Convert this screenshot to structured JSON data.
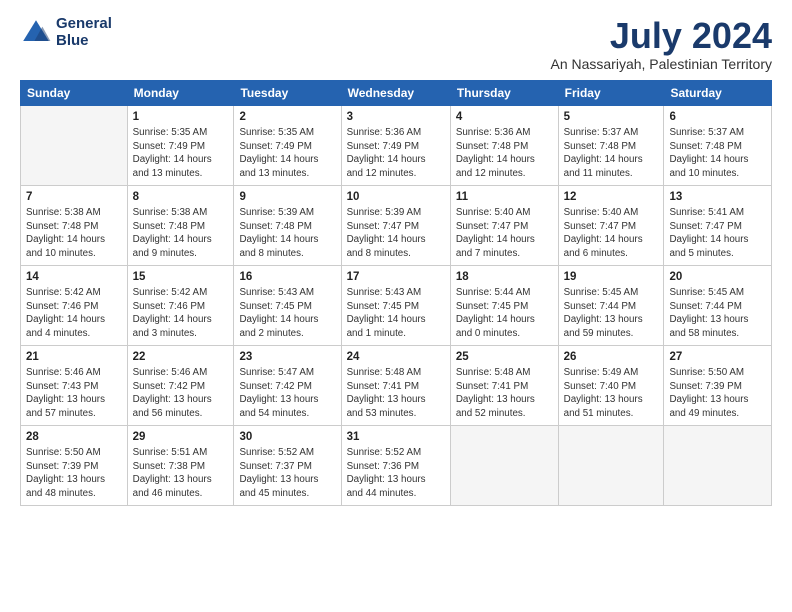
{
  "logo": {
    "line1": "General",
    "line2": "Blue"
  },
  "title": "July 2024",
  "subtitle": "An Nassariyah, Palestinian Territory",
  "header_days": [
    "Sunday",
    "Monday",
    "Tuesday",
    "Wednesday",
    "Thursday",
    "Friday",
    "Saturday"
  ],
  "weeks": [
    [
      {
        "day": "",
        "detail": ""
      },
      {
        "day": "1",
        "detail": "Sunrise: 5:35 AM\nSunset: 7:49 PM\nDaylight: 14 hours\nand 13 minutes."
      },
      {
        "day": "2",
        "detail": "Sunrise: 5:35 AM\nSunset: 7:49 PM\nDaylight: 14 hours\nand 13 minutes."
      },
      {
        "day": "3",
        "detail": "Sunrise: 5:36 AM\nSunset: 7:49 PM\nDaylight: 14 hours\nand 12 minutes."
      },
      {
        "day": "4",
        "detail": "Sunrise: 5:36 AM\nSunset: 7:48 PM\nDaylight: 14 hours\nand 12 minutes."
      },
      {
        "day": "5",
        "detail": "Sunrise: 5:37 AM\nSunset: 7:48 PM\nDaylight: 14 hours\nand 11 minutes."
      },
      {
        "day": "6",
        "detail": "Sunrise: 5:37 AM\nSunset: 7:48 PM\nDaylight: 14 hours\nand 10 minutes."
      }
    ],
    [
      {
        "day": "7",
        "detail": "Sunrise: 5:38 AM\nSunset: 7:48 PM\nDaylight: 14 hours\nand 10 minutes."
      },
      {
        "day": "8",
        "detail": "Sunrise: 5:38 AM\nSunset: 7:48 PM\nDaylight: 14 hours\nand 9 minutes."
      },
      {
        "day": "9",
        "detail": "Sunrise: 5:39 AM\nSunset: 7:48 PM\nDaylight: 14 hours\nand 8 minutes."
      },
      {
        "day": "10",
        "detail": "Sunrise: 5:39 AM\nSunset: 7:47 PM\nDaylight: 14 hours\nand 8 minutes."
      },
      {
        "day": "11",
        "detail": "Sunrise: 5:40 AM\nSunset: 7:47 PM\nDaylight: 14 hours\nand 7 minutes."
      },
      {
        "day": "12",
        "detail": "Sunrise: 5:40 AM\nSunset: 7:47 PM\nDaylight: 14 hours\nand 6 minutes."
      },
      {
        "day": "13",
        "detail": "Sunrise: 5:41 AM\nSunset: 7:47 PM\nDaylight: 14 hours\nand 5 minutes."
      }
    ],
    [
      {
        "day": "14",
        "detail": "Sunrise: 5:42 AM\nSunset: 7:46 PM\nDaylight: 14 hours\nand 4 minutes."
      },
      {
        "day": "15",
        "detail": "Sunrise: 5:42 AM\nSunset: 7:46 PM\nDaylight: 14 hours\nand 3 minutes."
      },
      {
        "day": "16",
        "detail": "Sunrise: 5:43 AM\nSunset: 7:45 PM\nDaylight: 14 hours\nand 2 minutes."
      },
      {
        "day": "17",
        "detail": "Sunrise: 5:43 AM\nSunset: 7:45 PM\nDaylight: 14 hours\nand 1 minute."
      },
      {
        "day": "18",
        "detail": "Sunrise: 5:44 AM\nSunset: 7:45 PM\nDaylight: 14 hours\nand 0 minutes."
      },
      {
        "day": "19",
        "detail": "Sunrise: 5:45 AM\nSunset: 7:44 PM\nDaylight: 13 hours\nand 59 minutes."
      },
      {
        "day": "20",
        "detail": "Sunrise: 5:45 AM\nSunset: 7:44 PM\nDaylight: 13 hours\nand 58 minutes."
      }
    ],
    [
      {
        "day": "21",
        "detail": "Sunrise: 5:46 AM\nSunset: 7:43 PM\nDaylight: 13 hours\nand 57 minutes."
      },
      {
        "day": "22",
        "detail": "Sunrise: 5:46 AM\nSunset: 7:42 PM\nDaylight: 13 hours\nand 56 minutes."
      },
      {
        "day": "23",
        "detail": "Sunrise: 5:47 AM\nSunset: 7:42 PM\nDaylight: 13 hours\nand 54 minutes."
      },
      {
        "day": "24",
        "detail": "Sunrise: 5:48 AM\nSunset: 7:41 PM\nDaylight: 13 hours\nand 53 minutes."
      },
      {
        "day": "25",
        "detail": "Sunrise: 5:48 AM\nSunset: 7:41 PM\nDaylight: 13 hours\nand 52 minutes."
      },
      {
        "day": "26",
        "detail": "Sunrise: 5:49 AM\nSunset: 7:40 PM\nDaylight: 13 hours\nand 51 minutes."
      },
      {
        "day": "27",
        "detail": "Sunrise: 5:50 AM\nSunset: 7:39 PM\nDaylight: 13 hours\nand 49 minutes."
      }
    ],
    [
      {
        "day": "28",
        "detail": "Sunrise: 5:50 AM\nSunset: 7:39 PM\nDaylight: 13 hours\nand 48 minutes."
      },
      {
        "day": "29",
        "detail": "Sunrise: 5:51 AM\nSunset: 7:38 PM\nDaylight: 13 hours\nand 46 minutes."
      },
      {
        "day": "30",
        "detail": "Sunrise: 5:52 AM\nSunset: 7:37 PM\nDaylight: 13 hours\nand 45 minutes."
      },
      {
        "day": "31",
        "detail": "Sunrise: 5:52 AM\nSunset: 7:36 PM\nDaylight: 13 hours\nand 44 minutes."
      },
      {
        "day": "",
        "detail": ""
      },
      {
        "day": "",
        "detail": ""
      },
      {
        "day": "",
        "detail": ""
      }
    ]
  ]
}
